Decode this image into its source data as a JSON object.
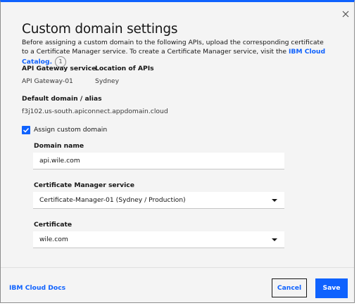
{
  "dialog": {
    "title": "Custom domain settings",
    "description": "Before assigning a custom domain to the following APIs, upload the corresponding certificate to a Certificate Manager service. To create a Certificate Manager service, visit the",
    "catalog_link": "IBM Cloud Catalog.",
    "badge": "1",
    "close_icon": "close-icon"
  },
  "info": {
    "gateway_label": "API Gateway service",
    "gateway_value": "API Gateway-01",
    "location_label": "Location of APIs",
    "location_value": "Sydney",
    "domain_label": "Default domain / alias",
    "domain_value": "f3j102.us-south.apiconnect.appdomain.cloud"
  },
  "assign": {
    "label": "Assign custom domain",
    "checked": true
  },
  "form": {
    "domain_name_label": "Domain name",
    "domain_name_value": "api.wile.com",
    "cert_manager_label": "Certificate Manager service",
    "cert_manager_value": "Certificate-Manager-01 (Sydney / Production)",
    "certificate_label": "Certificate",
    "certificate_value": "wile.com"
  },
  "footer": {
    "docs_link": "IBM Cloud Docs",
    "cancel_label": "Cancel",
    "save_label": "Save"
  },
  "colors": {
    "accent": "#0f62fe",
    "background": "#f4f4f4",
    "field": "#ffffff"
  }
}
